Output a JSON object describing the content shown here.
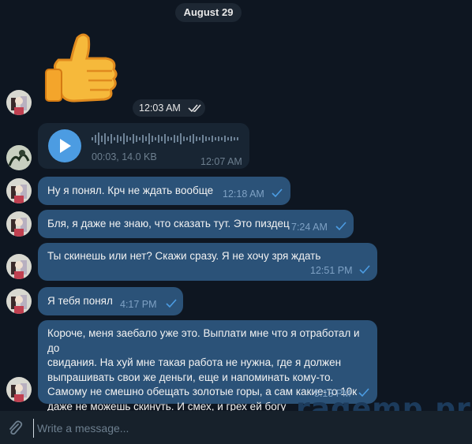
{
  "date_header": "August 29",
  "sticker": {
    "emoji": "👍",
    "time": "12:03 AM"
  },
  "voice": {
    "meta": "00:03, 14.0 KB",
    "time": "12:07 AM"
  },
  "messages": [
    {
      "text": "Ну я понял. Крч не ждать вообще",
      "time": "12:18 AM"
    },
    {
      "text": "Бля, я даже не знаю, что сказать тут. Это пиздец",
      "time": "7:24 AM"
    },
    {
      "text": "Ты скинешь или нет? Скажи сразу. Я не хочу зря ждать",
      "time": "12:51 PM"
    },
    {
      "text": "Я тебя понял",
      "time": "4:17 PM"
    }
  ],
  "long_message": {
    "lines": [
      "Короче, меня заебало уже это. Выплати мне что я отработал и до",
      "свидания. На хуй мне такая работа не нужна, где я должен",
      "выпрашивать свои же деньги, еще и напоминать кому-то.",
      "Самому не смешно обещать золотые горы, а сам какие-то 10к",
      "даже не можешь скинуть. И смех, и грех ей богу"
    ],
    "time": "5:13 PM"
  },
  "composer": {
    "placeholder": "Write a message..."
  },
  "watermark": "ragemp.pro",
  "icons": {
    "attach": "paperclip-icon",
    "play": "play-icon",
    "read": "double-check-icon",
    "sent": "check-icon"
  },
  "colors": {
    "background": "#0e1621",
    "outgoing_bubble": "#2b5278",
    "incoming_bubble": "#182533",
    "accent": "#4c9ce2"
  }
}
